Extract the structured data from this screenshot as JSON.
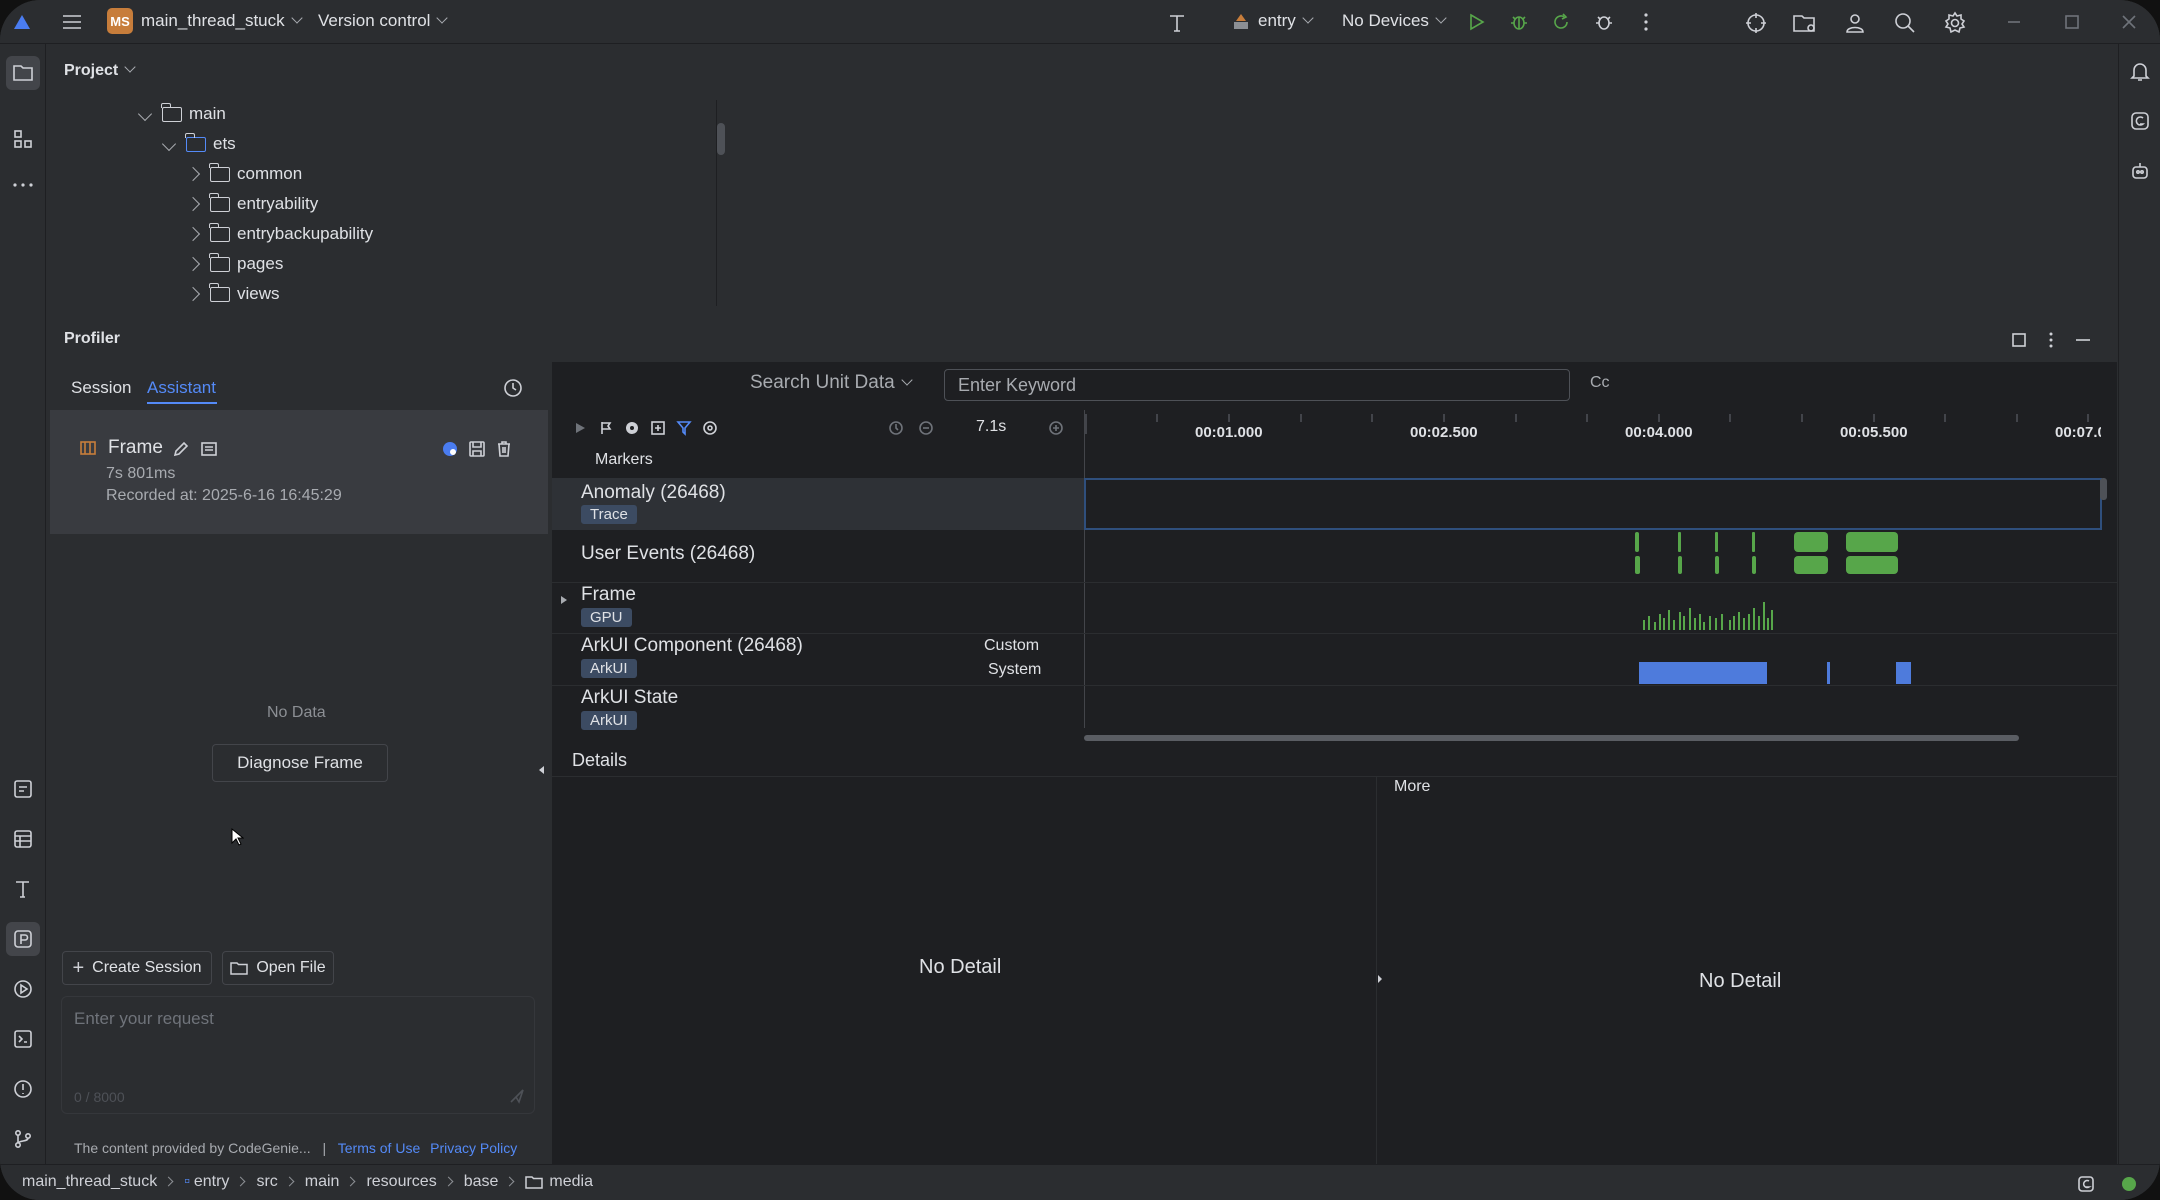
{
  "titlebar": {
    "project_badge": "MS",
    "project_name": "main_thread_stuck",
    "version_control": "Version control",
    "module": "entry",
    "devices": "No Devices"
  },
  "project_panel": {
    "title": "Project",
    "tree": [
      {
        "label": "main",
        "open": true
      },
      {
        "label": "ets",
        "open": true
      },
      {
        "label": "common",
        "open": false
      },
      {
        "label": "entryability",
        "open": false
      },
      {
        "label": "entrybackupability",
        "open": false
      },
      {
        "label": "pages",
        "open": false
      },
      {
        "label": "views",
        "open": false
      }
    ]
  },
  "profiler": {
    "title": "Profiler",
    "tabs": [
      "Session",
      "Assistant"
    ],
    "active_tab": "Assistant",
    "session": {
      "name": "Frame",
      "duration": "7s 801ms",
      "recorded": "Recorded at: 2025-6-16 16:45:29"
    },
    "no_data": "No Data",
    "diagnose_button": "Diagnose Frame",
    "create_session": "Create Session",
    "open_file": "Open File",
    "request_placeholder": "Enter your request",
    "char_count": "0 / 8000",
    "footer_note": "The content provided by CodeGenie...",
    "footer_sep": "|",
    "terms": "Terms of Use",
    "privacy": "Privacy Policy"
  },
  "timeline": {
    "search_mode": "Search Unit Data",
    "search_placeholder": "Enter Keyword",
    "case_toggle": "Cc",
    "zoom_value": "7.1s",
    "ruler": [
      "00:01.000",
      "00:02.500",
      "00:04.000",
      "00:05.500",
      "00:07.0"
    ],
    "markers_label": "Markers",
    "tracks": [
      {
        "name": "Anomaly (26468)",
        "tag": "Trace"
      },
      {
        "name": "User Events (26468)",
        "tag": ""
      },
      {
        "name": "Frame",
        "tag": "GPU"
      },
      {
        "name": "ArkUI Component (26468)",
        "tag": "ArkUI",
        "sub": [
          "Custom",
          "System"
        ]
      },
      {
        "name": "ArkUI State",
        "tag": "ArkUI"
      }
    ]
  },
  "details": {
    "title": "Details",
    "more": "More",
    "left_empty": "No Detail",
    "right_empty": "No Detail"
  },
  "statusbar": {
    "breadcrumb": [
      "main_thread_stuck",
      "entry",
      "src",
      "main",
      "resources",
      "base",
      "media"
    ]
  },
  "colors": {
    "accent": "#548af7",
    "green": "#57a64a",
    "blue_bar": "#4e7bdc",
    "bg": "#2b2d30",
    "panel": "#1e1f22"
  }
}
